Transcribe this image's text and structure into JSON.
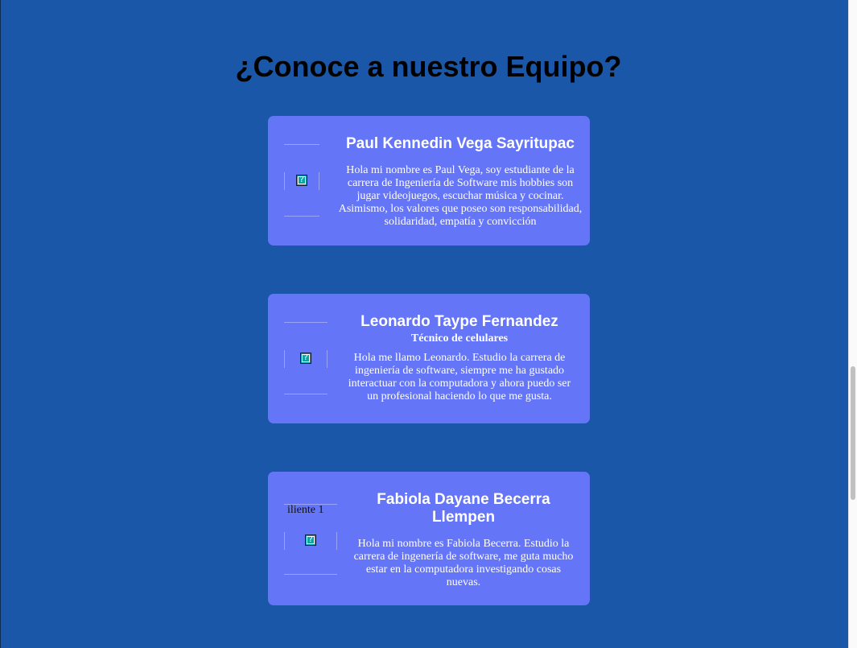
{
  "page": {
    "title": "¿Conoce a nuestro Equipo?"
  },
  "team": [
    {
      "name": "Paul Kennedin Vega Sayritupac",
      "role": "",
      "bio": "Hola mi nombre es Paul Vega, soy estudiante de la carrera de Ingeniería de Software mis hobbies son jugar videojuegos, escuchar música y cocinar. Asimismo, los valores que poseo son responsabilidad, solidaridad, empatía y convicción",
      "photo_alt": ""
    },
    {
      "name": "Leonardo Taype Fernandez",
      "role": "Técnico de celulares",
      "bio": "Hola me llamo Leonardo. Estudio la carrera de ingeniería de software, siempre me ha gustado interactuar con la computadora y ahora puedo ser un profesional haciendo lo que me gusta.",
      "photo_alt": ""
    },
    {
      "name": "Fabiola Dayane Becerra Llempen",
      "role": "",
      "bio": "Hola mi nombre es Fabiola Becerra. Estudio la carrera de ingenería de software, me guta mucho estar en la computadora investigando cosas nuevas.",
      "photo_alt": "iliente 1"
    }
  ],
  "icons": {
    "broken_image": "broken-image-icon"
  },
  "colors": {
    "background": "#1a57a8",
    "card": "#6475f7",
    "title_text": "#000000",
    "card_text": "#ffffff"
  }
}
